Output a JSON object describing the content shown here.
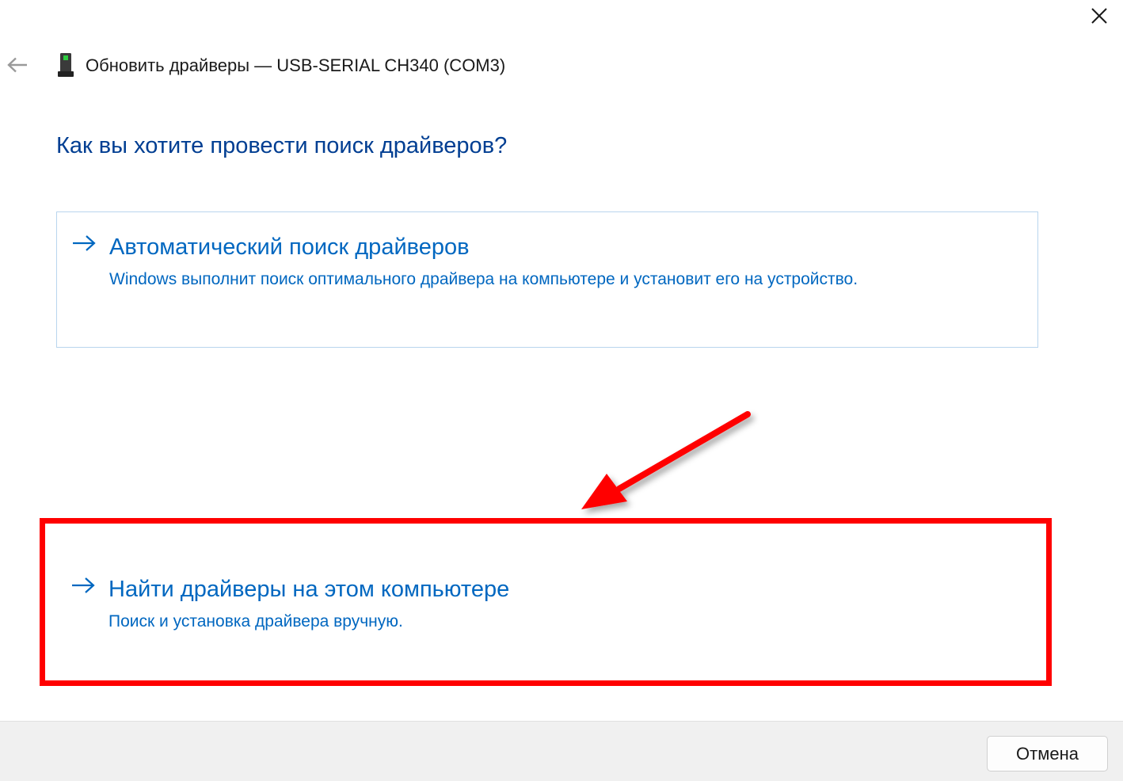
{
  "window": {
    "title": "Обновить драйверы — USB-SERIAL CH340 (COM3)",
    "close_icon": "close-icon",
    "back_icon": "back-arrow-icon",
    "device_icon": "usb-device-icon"
  },
  "main": {
    "heading": "Как вы хотите провести поиск драйверов?",
    "options": [
      {
        "icon": "arrow-right-icon",
        "title": "Автоматический поиск драйверов",
        "description": "Windows выполнит поиск оптимального драйвера на компьютере и установит его на устройство."
      },
      {
        "icon": "arrow-right-icon",
        "title": "Найти драйверы на этом компьютере",
        "description": "Поиск и установка драйвера вручную."
      }
    ]
  },
  "footer": {
    "cancel_label": "Отмена"
  },
  "colors": {
    "heading": "#003e92",
    "link": "#0067c0",
    "option_border": "#b9d5ee",
    "annotation": "#ff0000",
    "footer_bg": "#f0f0f0"
  }
}
